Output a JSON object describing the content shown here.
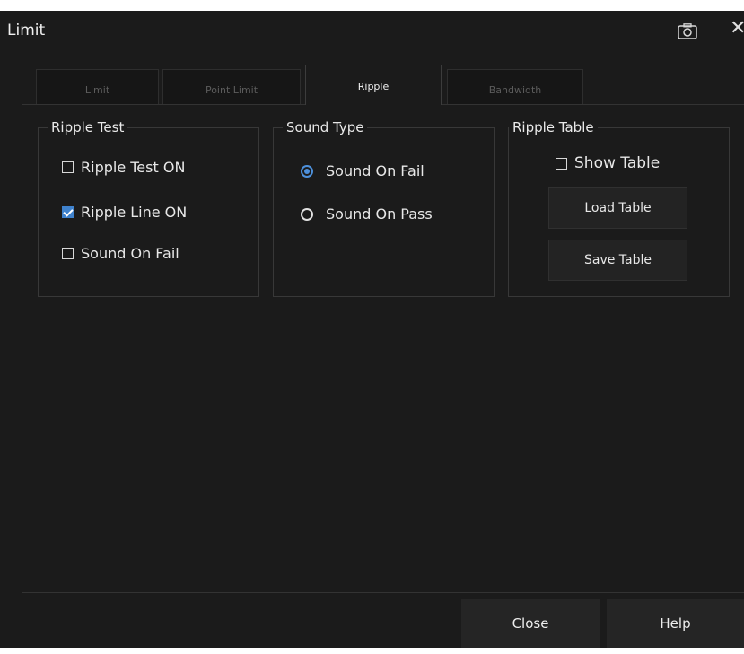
{
  "window": {
    "title": "Limit"
  },
  "icons": {
    "camera": "camera-icon",
    "close": "close-icon"
  },
  "tabs": [
    {
      "label": "Limit",
      "active": false
    },
    {
      "label": "Point Limit",
      "active": false
    },
    {
      "label": "Ripple",
      "active": true
    },
    {
      "label": "Bandwidth",
      "active": false
    }
  ],
  "ripple_test": {
    "title": "Ripple Test",
    "options": [
      {
        "label": "Ripple Test ON",
        "checked": false
      },
      {
        "label": "Ripple Line ON",
        "checked": true
      },
      {
        "label": "Sound On Fail",
        "checked": false
      }
    ]
  },
  "sound_type": {
    "title": "Sound Type",
    "options": [
      {
        "label": "Sound On Fail",
        "selected": true
      },
      {
        "label": "Sound On Pass",
        "selected": false
      }
    ]
  },
  "ripple_table": {
    "title": "Ripple Table",
    "show_table": {
      "label": "Show Table",
      "checked": false
    },
    "load_label": "Load Table",
    "save_label": "Save Table"
  },
  "footer": {
    "close_label": "Close",
    "help_label": "Help"
  },
  "colors": {
    "accent": "#3f82cd",
    "background": "#1b1b1b"
  }
}
